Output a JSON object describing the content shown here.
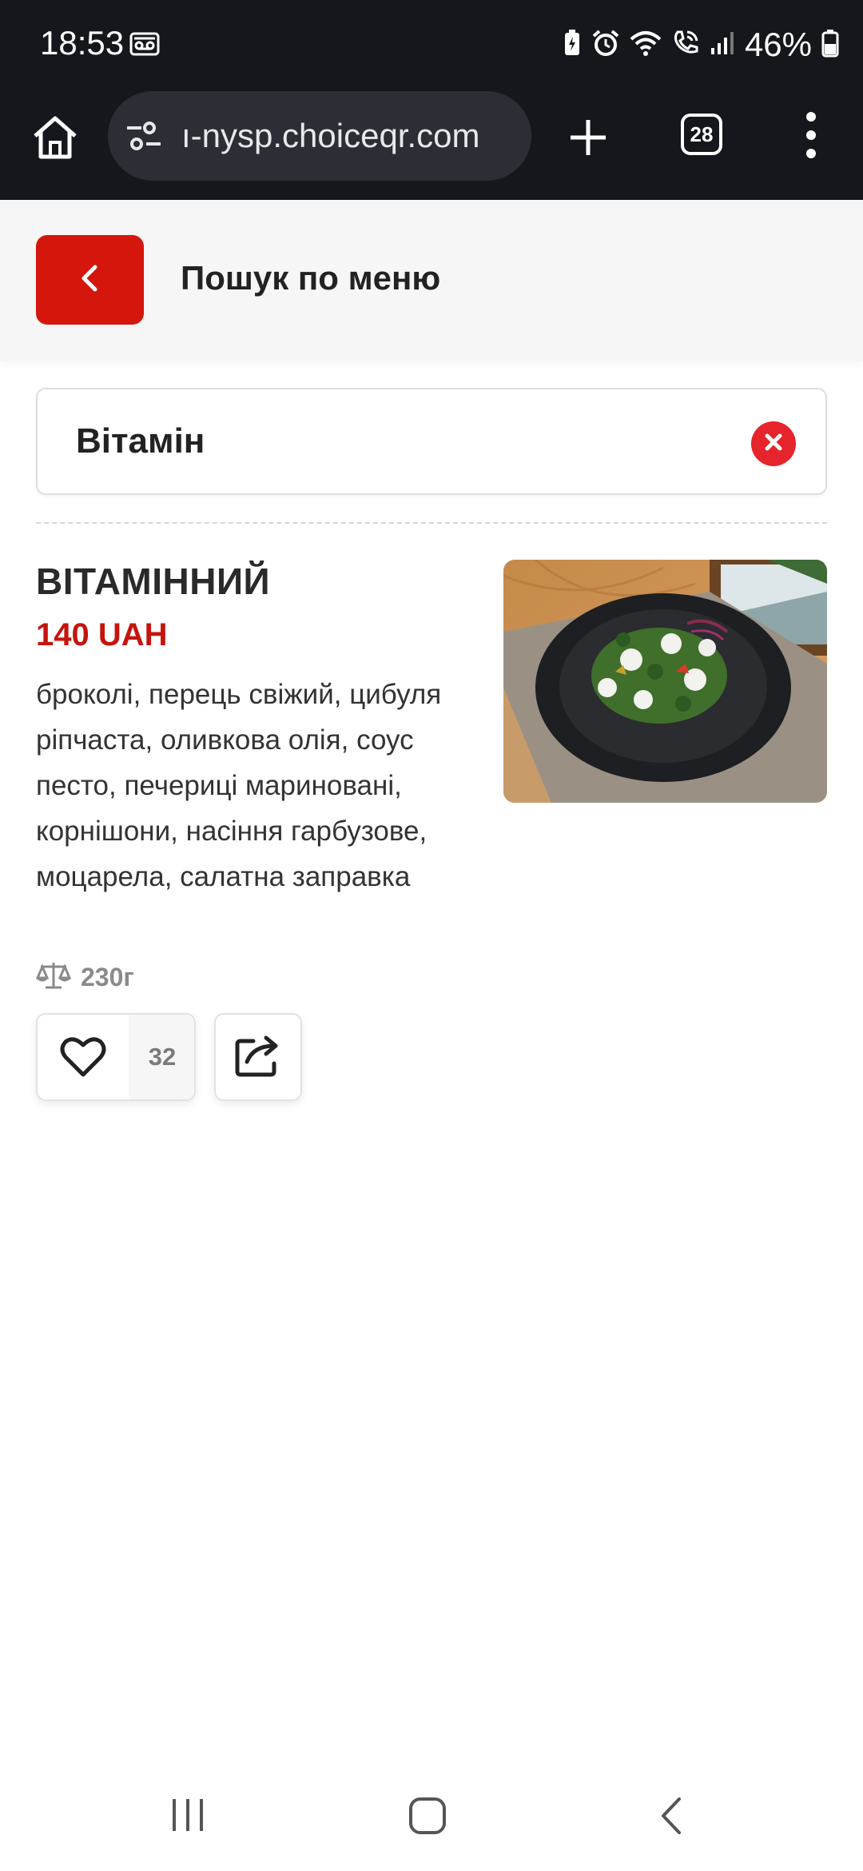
{
  "status_bar": {
    "time": "18:53",
    "battery_percent": "46%",
    "icons": [
      "voicemail-icon",
      "battery-saver-icon",
      "alarm-icon",
      "wifi-icon",
      "wifi-call-icon",
      "signal-icon",
      "battery-icon"
    ]
  },
  "browser": {
    "url": "ı-nysp.choiceqr.com",
    "tab_count": "28",
    "icons": [
      "home-icon",
      "site-settings-icon",
      "plus-icon",
      "tabs-icon",
      "more-vert-icon"
    ]
  },
  "header": {
    "title": "Пошук по меню",
    "back_icon": "chevron-left-icon"
  },
  "search": {
    "value": "Вітамін",
    "clear_icon": "close-circle-icon"
  },
  "item": {
    "name": "ВІТАМІННИЙ",
    "price": "140 UAH",
    "description": "броколі, перець свіжий, цибуля ріпчаста, оливкова олія, соус песто, печериці мариновані, корнішони, насіння гарбузове, моцарела, салатна заправка",
    "weight": "230г",
    "likes": "32",
    "photo_icon": "salad-photo"
  },
  "colors": {
    "accent": "#d5160d",
    "price": "#c5140d",
    "clear": "#e5242b",
    "browser_bg": "#15171c"
  },
  "nav": {
    "icons": [
      "recent-apps-icon",
      "home-button-icon",
      "back-icon"
    ]
  }
}
